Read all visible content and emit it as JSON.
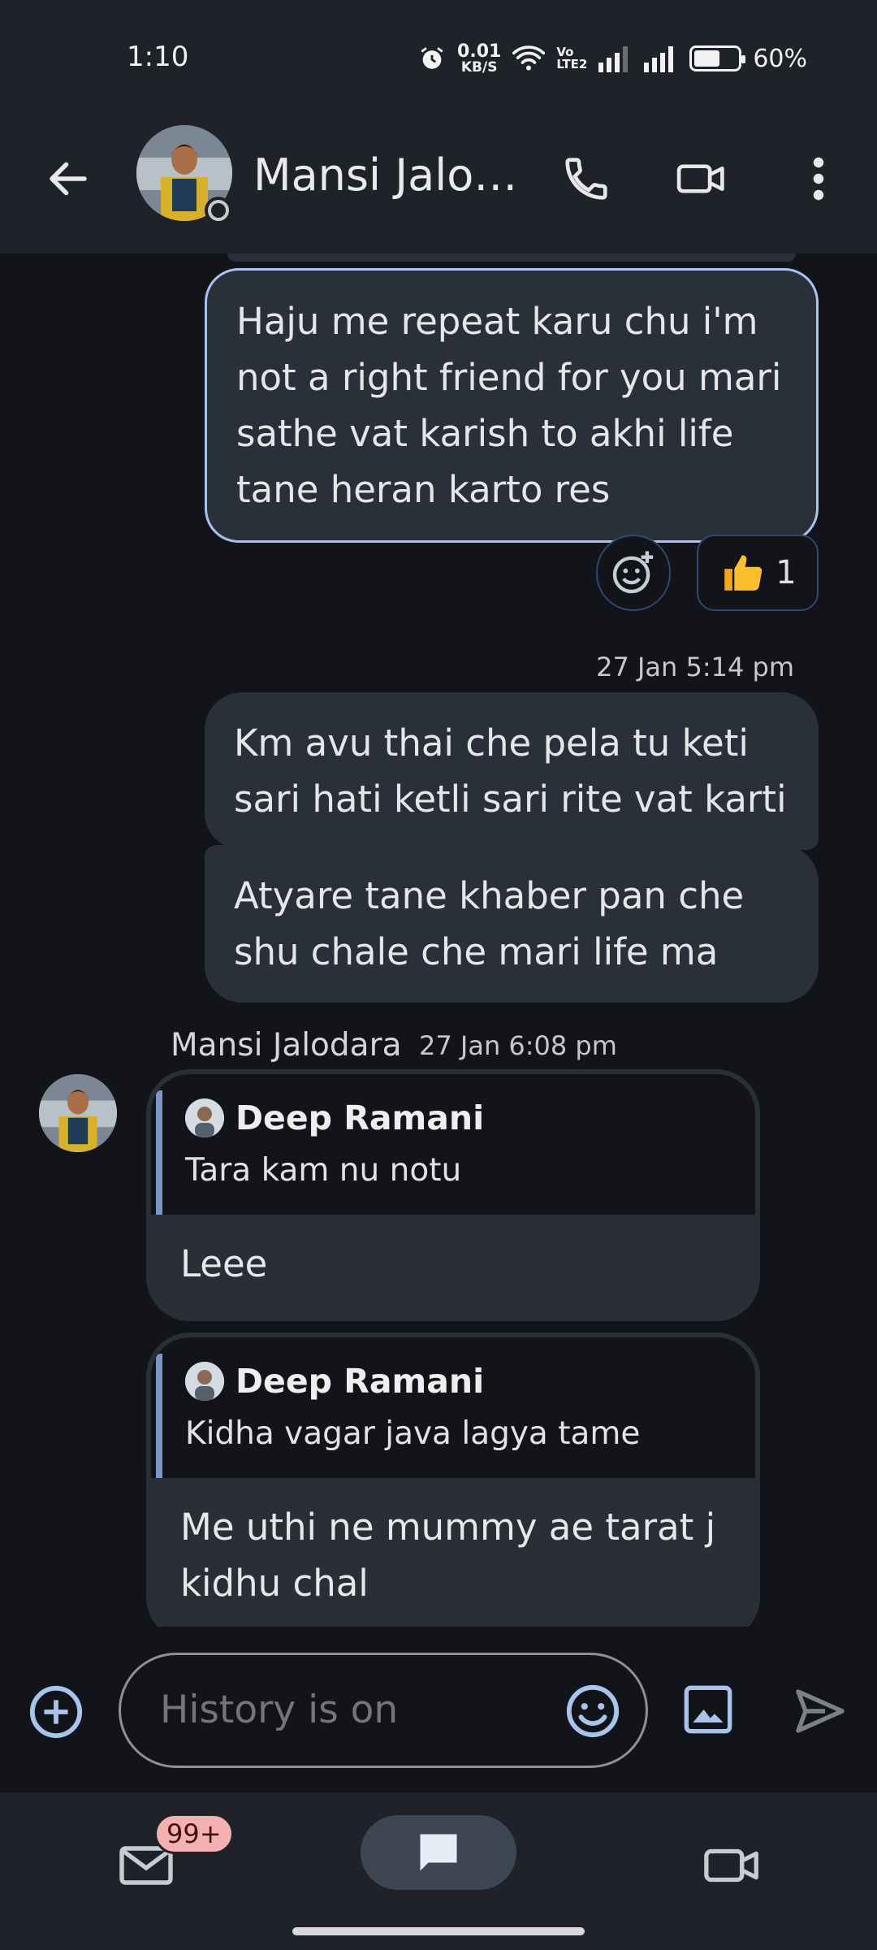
{
  "status_bar": {
    "time": "1:10",
    "speed_value": "0.01",
    "speed_unit": "KB/S",
    "volte_top": "Vo",
    "volte_bottom": "LTE2",
    "battery_level": 0.6,
    "battery_text": "60%",
    "icons": [
      "alarm-icon",
      "wifi-icon",
      "signal-icon",
      "signal-icon",
      "battery-icon"
    ]
  },
  "header": {
    "contact_name": "Mansi Jalo…",
    "icons": [
      "back-arrow-icon",
      "phone-icon",
      "video-camera-icon",
      "more-vert-icon"
    ]
  },
  "messages": {
    "outgoing_1": "Haju me repeat karu chu i'm not a right friend for you mari sathe vat karish to akhi life tane heran karto res",
    "reaction_count": "1",
    "timestamp_1": "27 Jan 5:14 pm",
    "outgoing_2": "Km avu thai che pela tu keti sari hati ketli sari rite vat karti",
    "outgoing_3": "Atyare tane khaber pan che shu chale che mari life ma",
    "incoming_sender": "Mansi Jalodara",
    "timestamp_2": "27 Jan 6:08 pm",
    "incoming": [
      {
        "quote_author": "Deep Ramani",
        "quote_text": "Tara kam nu notu",
        "body": "Leee"
      },
      {
        "quote_author": "Deep Ramani",
        "quote_text": "Kidha vagar java lagya tame",
        "body": "Me uthi ne mummy ae tarat j kidhu chal"
      }
    ]
  },
  "composer": {
    "placeholder": "History is on"
  },
  "bottom_nav": {
    "mail_badge": "99+"
  },
  "colors": {
    "background": "#12141a",
    "bar": "#1f2329",
    "bubble": "#2a3039",
    "accent": "#a9c4ec",
    "badge": "#f5b1b1"
  }
}
